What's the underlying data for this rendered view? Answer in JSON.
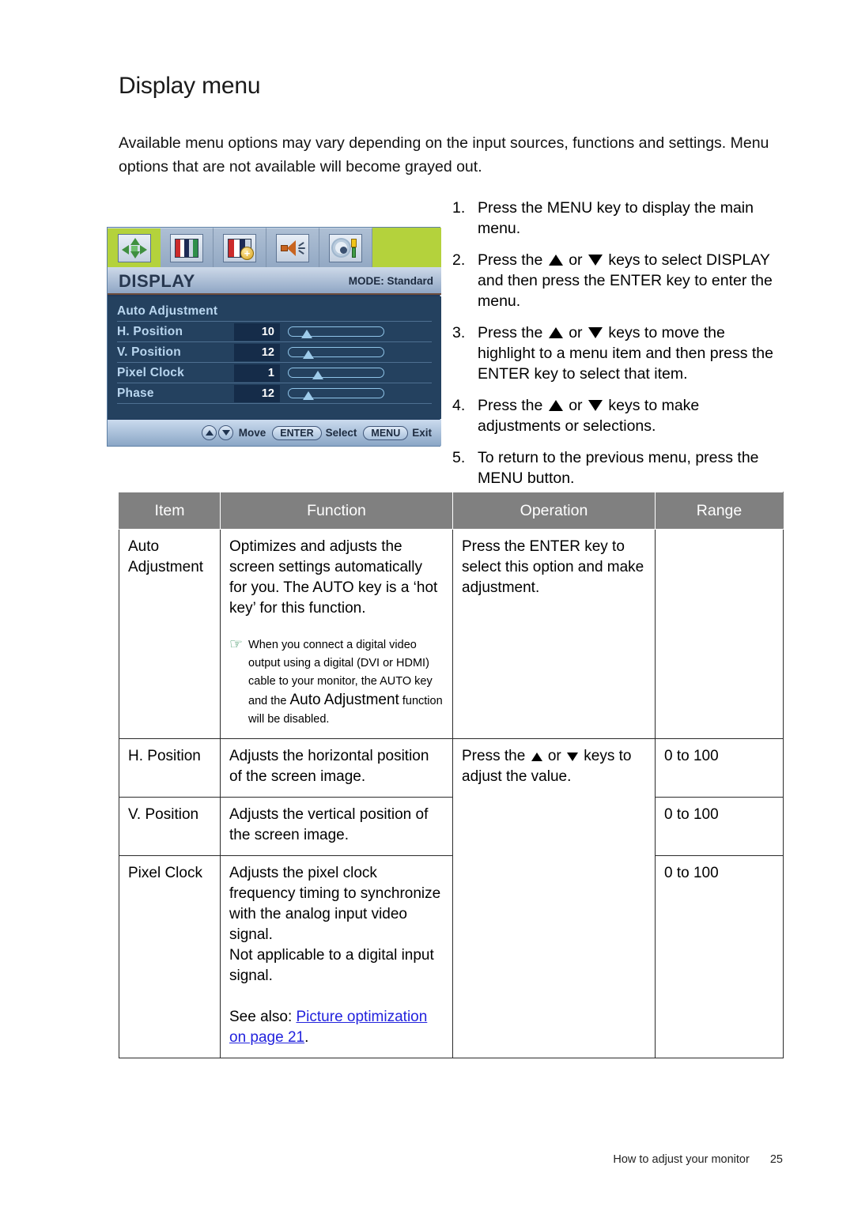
{
  "page": {
    "title": "Display menu",
    "intro": "Available menu options may vary depending on the input sources, functions and settings. Menu options that are not available will become grayed out.",
    "footer_text": "How to adjust your monitor",
    "footer_page": "25"
  },
  "osd": {
    "tabs": [
      {
        "name": "display-tab",
        "icon": "arrows-icon",
        "active": true
      },
      {
        "name": "picture-tab",
        "icon": "color-bars-icon",
        "active": false
      },
      {
        "name": "picture-advanced-tab",
        "icon": "color-bars-plus-icon",
        "active": false
      },
      {
        "name": "audio-tab",
        "icon": "speaker-icon",
        "active": false
      },
      {
        "name": "system-tab",
        "icon": "gear-screwdriver-icon",
        "active": false
      }
    ],
    "title": "DISPLAY",
    "mode": "MODE: Standard",
    "rows": [
      {
        "label": "Auto Adjustment",
        "value": "",
        "slider": null
      },
      {
        "label": "H. Position",
        "value": "10",
        "slider": 10
      },
      {
        "label": "V. Position",
        "value": "12",
        "slider": 12
      },
      {
        "label": "Pixel Clock",
        "value": "1",
        "slider": 30
      },
      {
        "label": "Phase",
        "value": "12",
        "slider": 12
      }
    ],
    "footer": {
      "move_label": "Move",
      "enter_label": "ENTER",
      "select_label": "Select",
      "menu_label": "MENU",
      "exit_label": "Exit"
    }
  },
  "steps": [
    {
      "num": "1.",
      "parts": [
        {
          "t": "text",
          "v": "Press the MENU key to display the main menu."
        }
      ]
    },
    {
      "num": "2.",
      "parts": [
        {
          "t": "text",
          "v": "Press the "
        },
        {
          "t": "tri-up"
        },
        {
          "t": "text",
          "v": " or "
        },
        {
          "t": "tri-dn"
        },
        {
          "t": "text",
          "v": " keys to select DISPLAY and then press the ENTER key to enter the menu."
        }
      ]
    },
    {
      "num": "3.",
      "parts": [
        {
          "t": "text",
          "v": "Press the "
        },
        {
          "t": "tri-up"
        },
        {
          "t": "text",
          "v": " or "
        },
        {
          "t": "tri-dn"
        },
        {
          "t": "text",
          "v": " keys to move the highlight to a menu item and then press the ENTER key to select that item."
        }
      ]
    },
    {
      "num": "4.",
      "parts": [
        {
          "t": "text",
          "v": "Press the "
        },
        {
          "t": "tri-up"
        },
        {
          "t": "text",
          "v": " or "
        },
        {
          "t": "tri-dn"
        },
        {
          "t": "text",
          "v": " keys to make adjustments or selections."
        }
      ]
    },
    {
      "num": "5.",
      "parts": [
        {
          "t": "text",
          "v": "To return to the previous menu, press the MENU button."
        }
      ]
    }
  ],
  "table": {
    "headers": [
      "Item",
      "Function",
      "Operation",
      "Range"
    ],
    "rows": [
      {
        "item": "Auto Adjustment",
        "function": "Optimizes and adjusts the screen settings automatically for you. The AUTO key is a ‘hot key’ for this function.",
        "note_icon": "pointing-hand-icon",
        "note": "When you connect a digital video output using a digital (DVI or HDMI) cable to your monitor, the AUTO key and the Auto Adjustment  function will be disabled.",
        "note_plain_1": "When you connect a digital video output using a digital (DVI or HDMI) cable to your monitor, the AUTO key and the ",
        "note_big": "Auto Adjustment",
        "note_plain_2": " function will be disabled.",
        "operation": "Press the ENTER key to select this option and make adjustment.",
        "range": ""
      },
      {
        "item": "H. Position",
        "function": "Adjusts the horizontal position of the screen image.",
        "operation_pre": "Press the ",
        "operation_post": " keys to adjust the value.",
        "operation_mid": " or ",
        "range": "0 to 100"
      },
      {
        "item": "V. Position",
        "function": "Adjusts the vertical position of the screen image.",
        "range": "0 to 100"
      },
      {
        "item": "Pixel Clock",
        "function": "Adjusts the pixel clock frequency timing to synchronize with the analog input video signal.\nNot applicable to a digital input signal.",
        "function_line1": "Adjusts the pixel clock frequency timing to synchronize with the analog input video signal.",
        "function_line2": "Not applicable to a digital input signal.",
        "seealso_prefix": "See also: ",
        "seealso_link": "Picture optimization on page 21",
        "seealso_suffix": ".",
        "range": "0 to 100"
      }
    ]
  },
  "colors": {
    "header_bg": "#808080",
    "link": "#2222dd",
    "note_icon": "#2e8b57",
    "osd_accent": "#b4d23c",
    "osd_body": "#24415f"
  }
}
